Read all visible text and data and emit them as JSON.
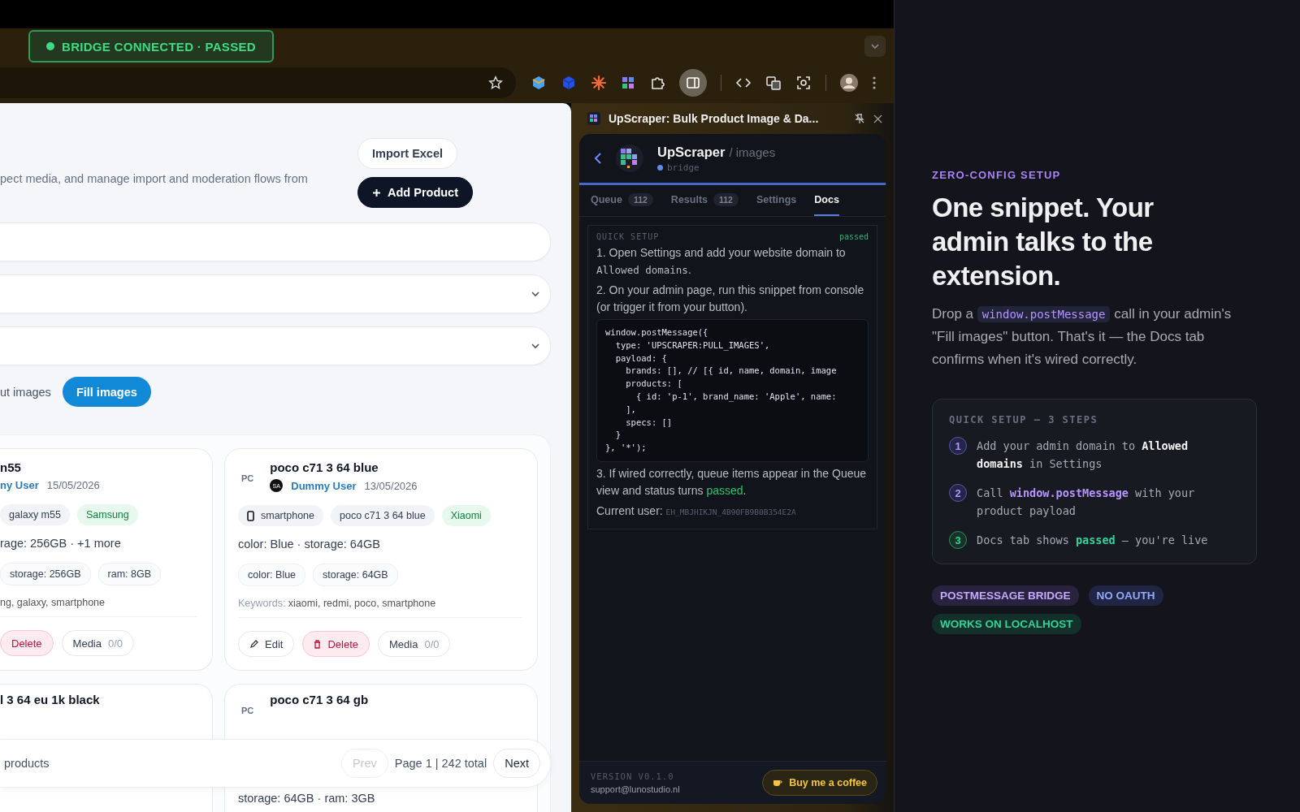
{
  "browser": {
    "badge": {
      "label": "BRIDGE CONNECTED · PASSED"
    }
  },
  "page": {
    "description": "pect media, and manage import and moderation flows from",
    "header_buttons": [
      {
        "label": "Import Excel",
        "kind": "secondary"
      },
      {
        "label": "Add Product",
        "kind": "primary"
      }
    ],
    "filter_label": "ut images",
    "fill_button": "Fill images",
    "cards": [
      {
        "title": "n55",
        "author": "ny User",
        "date": "15/05/2026",
        "chips": [
          {
            "label": "galaxy m55",
            "kind": "model"
          },
          {
            "label": "Samsung",
            "kind": "brand"
          }
        ],
        "specs": "rage: 256GB · +1 more",
        "spec_chips": [
          "storage: 256GB",
          "ram: 8GB"
        ],
        "keywords": "ng, galaxy, smartphone",
        "actions": [
          {
            "label": "Delete",
            "kind": "delete"
          },
          {
            "label": "Media",
            "count": "0/0",
            "kind": "media"
          }
        ]
      },
      {
        "initials": "PC",
        "title": "poco c71 3 64 blue",
        "avatar_initials": "SA",
        "author": "Dummy User",
        "date": "13/05/2026",
        "chips": [
          {
            "label": "smartphone",
            "kind": "device"
          },
          {
            "label": "poco c71 3 64 blue",
            "kind": "model"
          },
          {
            "label": "Xiaomi",
            "kind": "brand"
          }
        ],
        "specs": "color: Blue · storage: 64GB",
        "spec_chips": [
          "color: Blue",
          "storage: 64GB"
        ],
        "keywords_label": "Keywords:",
        "keywords": "xiaomi, redmi, poco, smartphone",
        "actions": [
          {
            "label": "Edit",
            "kind": "edit"
          },
          {
            "label": "Delete",
            "kind": "delete"
          },
          {
            "label": "Media",
            "count": "0/0",
            "kind": "media"
          }
        ]
      },
      {
        "title": "l 3 64 eu 1k black"
      },
      {
        "initials": "PC",
        "title": "poco c71 3 64 gb",
        "specs": "storage: 64GB · ram: 3GB"
      }
    ],
    "pagination": {
      "summary": "products",
      "prev": {
        "label": "Prev",
        "disabled": true
      },
      "page_info": "Page 1 | 242 total",
      "next": {
        "label": "Next",
        "disabled": false
      }
    }
  },
  "extension": {
    "window_title": "UpScraper: Bulk Product Image & Da...",
    "app_name": "UpScraper",
    "app_path": "/ images",
    "status": "bridge",
    "tabs": [
      {
        "label": "Queue",
        "count": "112",
        "selected": false
      },
      {
        "label": "Results",
        "count": "112",
        "selected": false
      },
      {
        "label": "Settings",
        "selected": false
      },
      {
        "label": "Docs",
        "selected": true
      }
    ],
    "docs": {
      "heading": "QUICK SETUP",
      "status": "passed",
      "step_1": {
        "text": "1. Open Settings and add your website domain to",
        "code": "Allowed domains",
        "after": "."
      },
      "step_2": "2. On your admin page, run this snippet from console (or trigger it from your button).",
      "code_lines": [
        "window.postMessage({",
        "  type: 'UPSCRAPER:PULL_IMAGES',",
        "  payload: {",
        "    brands: [], // [{ id, name, domain, image",
        "    products: [",
        "      { id: 'p-1', brand_name: 'Apple', name:",
        "    ],",
        "    specs: []",
        "  }",
        "}, '*');"
      ],
      "step_3": "3. If wired correctly, queue items appear in the Queue view and status turns **passed**.",
      "user_label": "Current user:",
      "user_id": "EH_MBJHIKJN_4B90FB9B0B354E2A"
    },
    "version": "VERSION V0.1.0",
    "support": "support@lunostudio.nl",
    "coffee_button": "Buy me a coffee"
  },
  "promo": {
    "eyebrow": "ZERO-CONFIG SETUP",
    "headline": "One snippet. Your admin talks to the extension.",
    "intro": {
      "before": "Drop a",
      "code": "window.postMessage",
      "after": "call in your admin's \"Fill images\" button. That's it — the Docs tab confirms when it's wired correctly."
    },
    "box_title": "QUICK SETUP — 3 STEPS",
    "steps": [
      {
        "number": "1",
        "kind": "setting",
        "text": "Add your admin domain to **Allowed domains** in Settings"
      },
      {
        "number": "2",
        "kind": "code",
        "text": "Call **window.postMessage** with your product payload"
      },
      {
        "number": "3",
        "kind": "status",
        "text": "Docs tab shows **passed** — you're live"
      }
    ],
    "tags": [
      {
        "label": "POSTMESSAGE BRIDGE",
        "kind": "bridge"
      },
      {
        "label": "NO OAUTH",
        "kind": "auth"
      },
      {
        "label": "WORKS ON LOCALHOST",
        "kind": "local"
      }
    ]
  }
}
